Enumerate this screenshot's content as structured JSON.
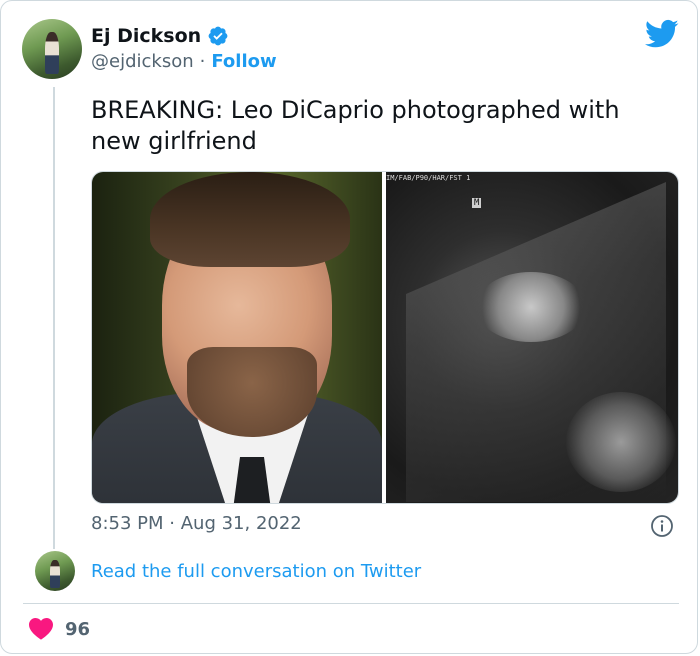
{
  "author": {
    "name": "Ej Dickson",
    "handle": "@ejdickson",
    "separator": "·",
    "follow_label": "Follow"
  },
  "tweet": {
    "text": "BREAKING: Leo DiCaprio photographed with new girlfriend",
    "time": "8:53 PM",
    "date_separator": "·",
    "date": "Aug 31, 2022"
  },
  "media": {
    "ultrasound_header": "IM/FAB/P90/HAR/FST 1",
    "ultrasound_marker": "M"
  },
  "footer": {
    "read_link": "Read the full conversation on Twitter",
    "likes": "96"
  },
  "colors": {
    "accent": "#1d9bf0",
    "heart": "#f91880",
    "text": "#0f1419",
    "secondary": "#536471"
  },
  "icons": [
    "verified-badge-icon",
    "twitter-bird-icon",
    "info-icon",
    "heart-icon"
  ]
}
